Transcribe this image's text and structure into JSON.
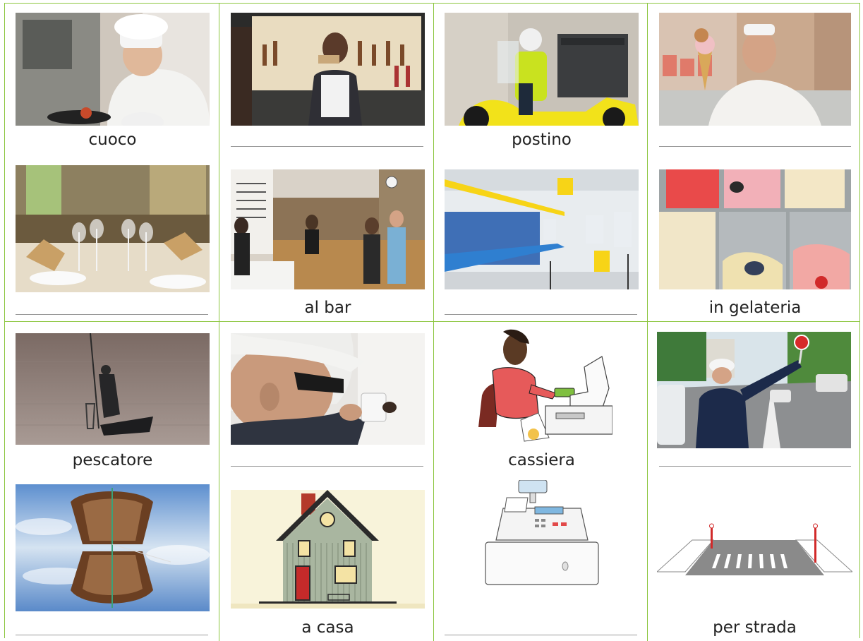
{
  "accent_color": "#8cc63f",
  "cards": [
    {
      "id": "chef",
      "icon": "chef-photo",
      "label": "cuoco"
    },
    {
      "id": "barista",
      "icon": "barista-photo",
      "label": ""
    },
    {
      "id": "postman",
      "icon": "postman-photo",
      "label": "postino"
    },
    {
      "id": "icecream-man",
      "icon": "gelato-maker-photo",
      "label": ""
    },
    {
      "id": "restaurant",
      "icon": "restaurant-photo",
      "label": ""
    },
    {
      "id": "bar",
      "icon": "cafe-bar-photo",
      "label": "al bar"
    },
    {
      "id": "post-office",
      "icon": "post-office-photo",
      "label": ""
    },
    {
      "id": "gelateria",
      "icon": "gelato-display-photo",
      "label": "in gelateria"
    },
    {
      "id": "fisherman",
      "icon": "fisherman-photo",
      "label": "pescatore"
    },
    {
      "id": "electrician",
      "icon": "electrician-photo",
      "label": ""
    },
    {
      "id": "cashier",
      "icon": "cashier-illustration",
      "label": "cassiera"
    },
    {
      "id": "traffic-officer",
      "icon": "traffic-officer-photo",
      "label": ""
    },
    {
      "id": "boat",
      "icon": "boat-photo",
      "label": ""
    },
    {
      "id": "house",
      "icon": "house-illustration",
      "label": "a casa"
    },
    {
      "id": "cash-register",
      "icon": "cash-register-illustration",
      "label": ""
    },
    {
      "id": "street",
      "icon": "crosswalk-illustration",
      "label": "per strada"
    }
  ]
}
